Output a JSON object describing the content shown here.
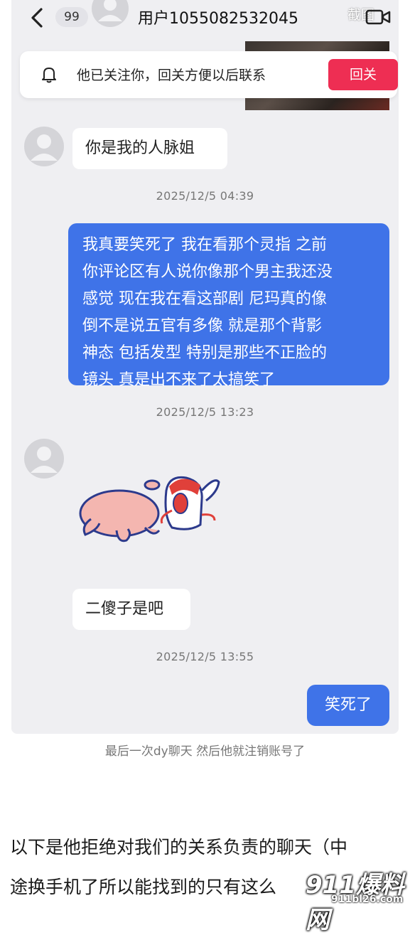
{
  "header": {
    "back_icon": "chevron-left-icon",
    "unread_badge": "99",
    "username": "用户1055082532045",
    "camera_label": "截图",
    "video_icon": "video-camera-icon"
  },
  "follow_banner": {
    "icon": "bell-icon",
    "text": "他已关注你，回关方便以后联系",
    "button_label": "回关",
    "button_color": "#ee2e53"
  },
  "messages": [
    {
      "direction": "in",
      "type": "text",
      "text": "你是我的人脉姐"
    },
    {
      "direction": "timestamp",
      "text": "2025/12/5 04:39"
    },
    {
      "direction": "out",
      "type": "text",
      "lines": [
        "我真要笑死了 我在看那个灵指 之前",
        "你评论区有人说你像那个男主我还没",
        "感觉 现在我在看这部剧 尼玛真的像",
        "倒不是说五官有多像 就是那个背影",
        "神态 包括发型 特别是那些不正脸的",
        "镜头 真是出不来了太搞笑了"
      ]
    },
    {
      "direction": "timestamp",
      "text": "2025/12/5 13:23"
    },
    {
      "direction": "in",
      "type": "sticker",
      "sticker": "screaming-cartoon-sticker"
    },
    {
      "direction": "in",
      "type": "text",
      "text": "二傻子是吧"
    },
    {
      "direction": "timestamp",
      "text": "2025/12/5 13:55"
    },
    {
      "direction": "out",
      "type": "text",
      "text": "笑死了"
    }
  ],
  "caption": "最后一次dy聊天 然后他就注销账号了",
  "body_text": [
    "以下是他拒绝对我们的关系负责的聊天（中",
    "途换手机了所以能找到的只有这么"
  ],
  "watermark": {
    "text": "911爆料网",
    "url": "911bl26.com"
  },
  "colors": {
    "outgoing_bubble": "#3f73e8",
    "chat_background": "#efeff2"
  }
}
